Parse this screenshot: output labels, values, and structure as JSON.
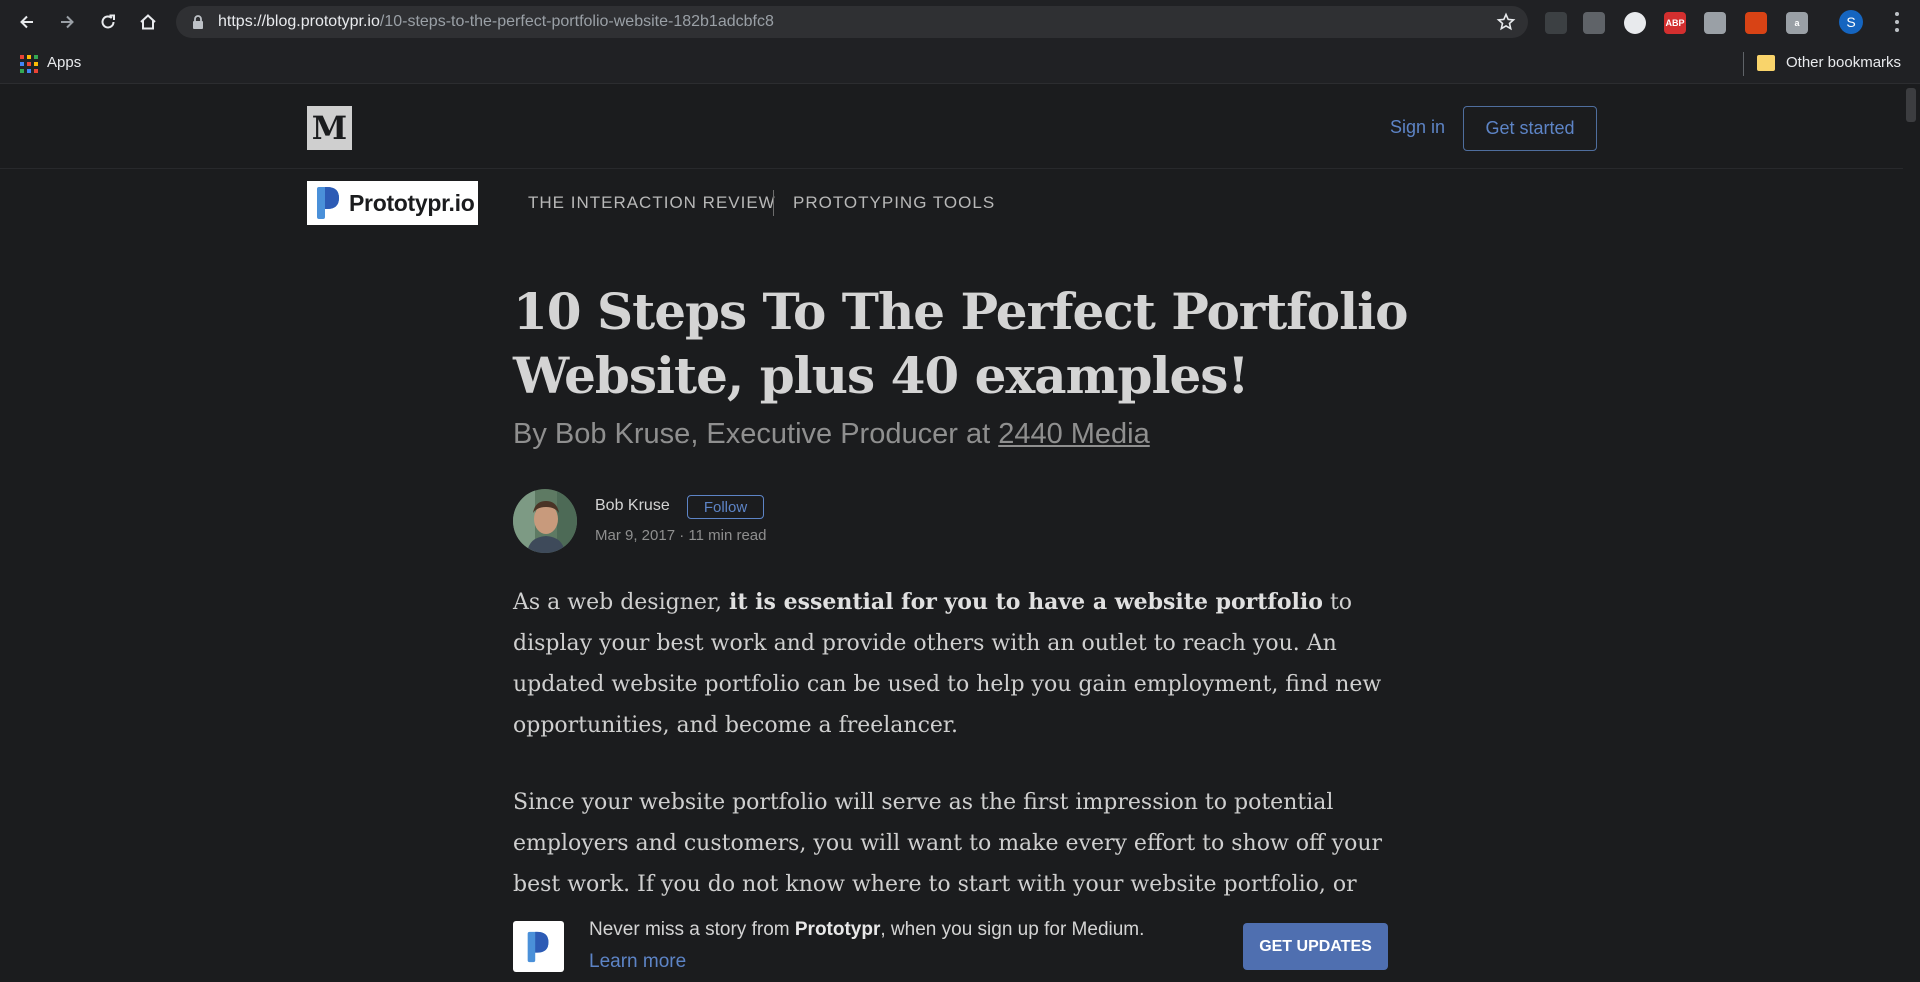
{
  "browser": {
    "url_host": "https://blog.prototypr.io",
    "url_path": "/10-steps-to-the-perfect-portfolio-website-182b1adcbfc8",
    "bookmarks": {
      "apps_label": "Apps",
      "other_label": "Other bookmarks"
    },
    "extensions": [
      {
        "name": "robot-extension-icon",
        "color": "#3c4043",
        "text": ""
      },
      {
        "name": "bulb-extension-icon",
        "color": "#5f6368",
        "text": ""
      },
      {
        "name": "speedometer-extension-icon",
        "color": "#e8eaed",
        "text": ""
      },
      {
        "name": "adblock-extension-icon",
        "color": "#d32f2f",
        "text": "ABP"
      },
      {
        "name": "pin-extension-icon",
        "color": "#9aa0a6",
        "text": ""
      },
      {
        "name": "office-extension-icon",
        "color": "#d84315",
        "text": ""
      },
      {
        "name": "bag-extension-icon",
        "color": "#9aa0a6",
        "text": "a"
      }
    ],
    "profile_initial": "S"
  },
  "header": {
    "logo_letter": "M",
    "signin_label": "Sign in",
    "get_started_label": "Get started"
  },
  "publication": {
    "name": "Prototypr.io",
    "nav": [
      "THE INTERACTION REVIEW",
      "PROTOTYPING TOOLS"
    ]
  },
  "article": {
    "title": "10 Steps To The Perfect Portfolio Website, plus 40 examples!",
    "subtitle_prefix": "By Bob Kruse, Executive Producer at ",
    "subtitle_link": "2440 Media",
    "author": "Bob Kruse",
    "follow_label": "Follow",
    "meta": "Mar 9, 2017 · 11 min read",
    "paragraph1": {
      "before": "As a web designer, ",
      "bold": "it is essential for you to have a website portfolio",
      "after": " to display your best work and provide others with an outlet to reach you. An updated website portfolio can be used to help you gain employment, find new opportunities, and become a freelancer."
    },
    "paragraph2": "Since your website portfolio will serve as the first impression to potential employers and customers, you will want to make every effort to show off your best work. If you do not know where to start with your website portfolio, or"
  },
  "banner": {
    "text_before": "Never miss a story from ",
    "text_bold": "Prototypr",
    "text_after": ", when you sign up for Medium.",
    "learn_more": "Learn more",
    "cta": "GET UPDATES"
  },
  "colors": {
    "page_bg": "#1b1c1e",
    "accent": "#5d84c6",
    "cta_bg": "#4f6fb0"
  }
}
